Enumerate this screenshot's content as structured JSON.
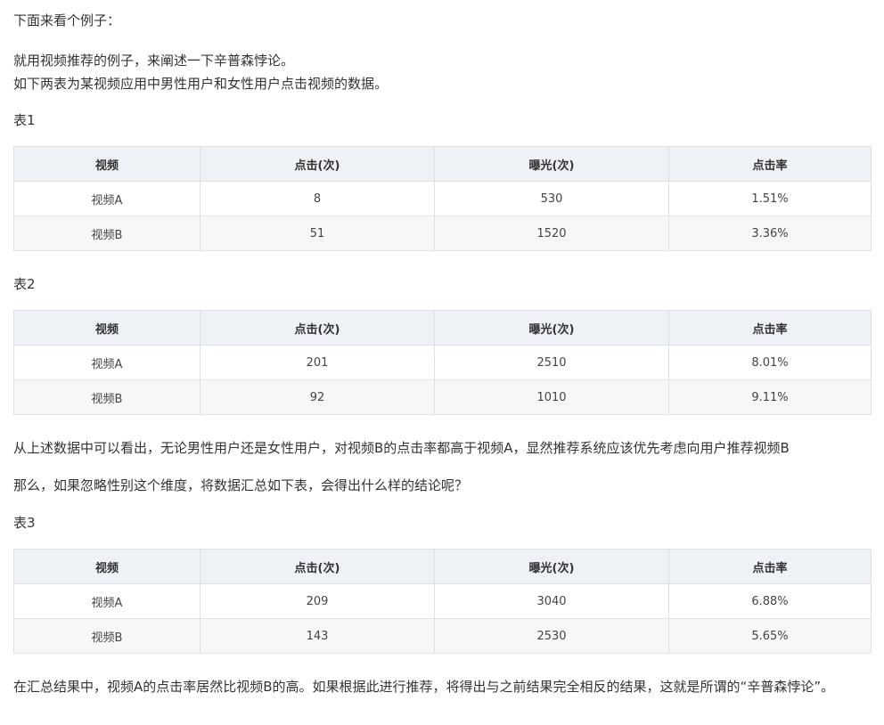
{
  "paragraphs": {
    "intro": "下面来看个例子：",
    "p1_line1": "就用视频推荐的例子，来阐述一下辛普森悖论。",
    "p1_line2": "如下两表为某视频应用中男性用户和女性用户点击视频的数据。",
    "observe": "从上述数据中可以看出，无论男性用户还是女性用户，对视频B的点击率都高于视频A，显然推荐系统应该优先考虑向用户推荐视频B",
    "question": "那么，如果忽略性别这个维度，将数据汇总如下表，会得出什么样的结论呢？",
    "conclusion": "在汇总结果中，视频A的点击率居然比视频B的高。如果根据此进行推荐，将得出与之前结果完全相反的结果，这就是所谓的“辛普森悖论”。"
  },
  "tables": [
    {
      "caption": "表1",
      "headers": [
        "视频",
        "点击(次)",
        "曝光(次)",
        "点击率"
      ],
      "rows": [
        [
          "视频A",
          "8",
          "530",
          "1.51%"
        ],
        [
          "视频B",
          "51",
          "1520",
          "3.36%"
        ]
      ]
    },
    {
      "caption": "表2",
      "headers": [
        "视频",
        "点击(次)",
        "曝光(次)",
        "点击率"
      ],
      "rows": [
        [
          "视频A",
          "201",
          "2510",
          "8.01%"
        ],
        [
          "视频B",
          "92",
          "1010",
          "9.11%"
        ]
      ]
    },
    {
      "caption": "表3",
      "headers": [
        "视频",
        "点击(次)",
        "曝光(次)",
        "点击率"
      ],
      "rows": [
        [
          "视频A",
          "209",
          "3040",
          "6.88%"
        ],
        [
          "视频B",
          "143",
          "2530",
          "5.65%"
        ]
      ]
    }
  ]
}
